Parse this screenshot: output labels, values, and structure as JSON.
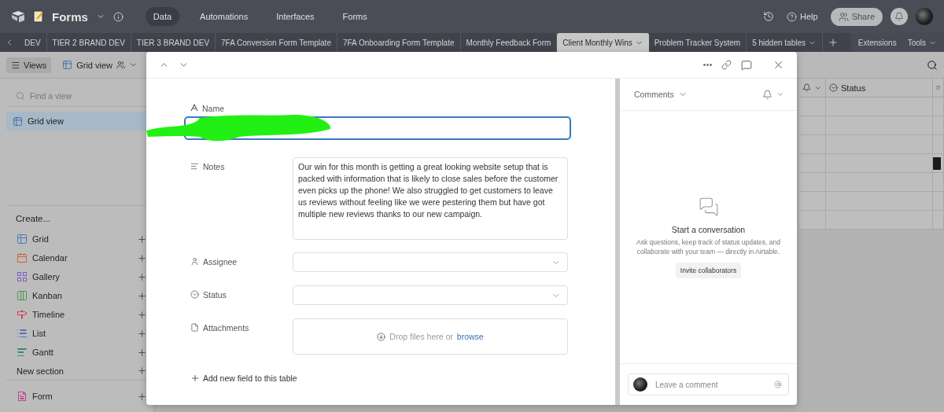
{
  "top_bar": {
    "base_name": "Forms",
    "nav": [
      {
        "label": "Data",
        "selected": true
      },
      {
        "label": "Automations",
        "selected": false
      },
      {
        "label": "Interfaces",
        "selected": false
      },
      {
        "label": "Forms",
        "selected": false
      }
    ],
    "help": "Help",
    "share": "Share"
  },
  "table_tabs": {
    "items": [
      {
        "label": "DEV",
        "selected": false
      },
      {
        "label": "TIER 2 BRAND DEV",
        "selected": false
      },
      {
        "label": "TIER 3 BRAND DEV",
        "selected": false
      },
      {
        "label": "7FA Conversion Form Template",
        "selected": false
      },
      {
        "label": "7FA Onboarding Form Template",
        "selected": false
      },
      {
        "label": "Monthly Feedback Form",
        "selected": false
      },
      {
        "label": "Client Monthly Wins",
        "selected": true
      },
      {
        "label": "Problem Tracker System",
        "selected": false
      }
    ],
    "hidden": "5 hidden tables",
    "extensions": "Extensions",
    "tools": "Tools"
  },
  "view_bar": {
    "views": "Views",
    "current_view": "Grid view"
  },
  "sidebar": {
    "search_placeholder": "Find a view",
    "views": [
      {
        "label": "Grid view",
        "selected": true
      }
    ],
    "create_heading": "Create...",
    "create_items": [
      {
        "kind": "grid",
        "label": "Grid",
        "color": "#4a78b8"
      },
      {
        "kind": "calendar",
        "label": "Calendar",
        "color": "#c8663a"
      },
      {
        "kind": "gallery",
        "label": "Gallery",
        "color": "#7a5cc9"
      },
      {
        "kind": "kanban",
        "label": "Kanban",
        "color": "#3f9a4e"
      },
      {
        "kind": "timeline",
        "label": "Timeline",
        "color": "#c9455f"
      },
      {
        "kind": "list",
        "label": "List",
        "color": "#5a6fb5"
      },
      {
        "kind": "gantt",
        "label": "Gantt",
        "color": "#3a8a7a"
      }
    ],
    "new_section": "New section",
    "form_items": [
      {
        "kind": "form",
        "label": "Form",
        "color": "#c0488e"
      }
    ]
  },
  "grid": {
    "columns": [
      "Status"
    ]
  },
  "record": {
    "fields": [
      {
        "kind": "text",
        "label": "Name",
        "focused": true
      },
      {
        "kind": "long_text",
        "label": "Notes",
        "value": "Our win for this month is getting a great looking website setup that is packed with information that is likely to close sales before the customer even picks up the phone! We also struggled to get customers to leave us reviews without feeling like we were pestering them but have got multiple new reviews thanks to our new campaign."
      },
      {
        "kind": "user",
        "label": "Assignee"
      },
      {
        "kind": "select",
        "label": "Status"
      },
      {
        "kind": "attachment",
        "label": "Attachments",
        "drop_text": "Drop files here or",
        "browse": "browse"
      }
    ],
    "add_field": "Add new field to this table"
  },
  "comments": {
    "title": "Comments",
    "empty_title": "Start a conversation",
    "empty_text": "Ask questions, keep track of status updates, and collaborate with your team — directly in Airtable.",
    "invite": "Invite collaborators",
    "placeholder": "Leave a comment"
  }
}
